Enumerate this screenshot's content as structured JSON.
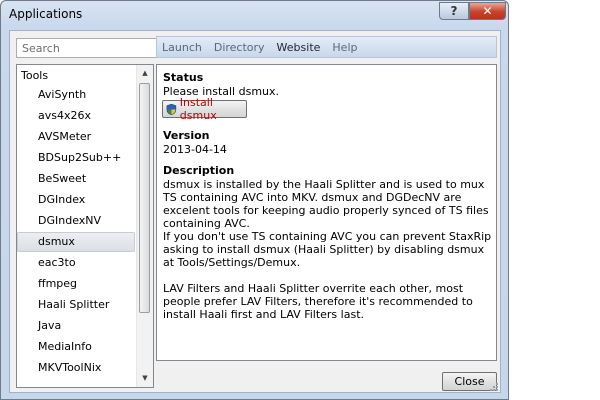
{
  "window": {
    "title": "Applications",
    "help_label": "?",
    "close_glyph": "✕"
  },
  "search": {
    "placeholder": "Search",
    "value": ""
  },
  "menu": [
    {
      "label": "Launch",
      "active": false
    },
    {
      "label": "Directory",
      "active": false
    },
    {
      "label": "Website",
      "active": true
    },
    {
      "label": "Help",
      "active": false
    }
  ],
  "tree": {
    "root": "Tools",
    "items": [
      {
        "label": "AviSynth"
      },
      {
        "label": "avs4x26x"
      },
      {
        "label": "AVSMeter"
      },
      {
        "label": "BDSup2Sub++"
      },
      {
        "label": "BeSweet"
      },
      {
        "label": "DGIndex"
      },
      {
        "label": "DGIndexNV"
      },
      {
        "label": "dsmux",
        "selected": true
      },
      {
        "label": "eac3to"
      },
      {
        "label": "ffmpeg"
      },
      {
        "label": "Haali Splitter"
      },
      {
        "label": "Java"
      },
      {
        "label": "MediaInfo"
      },
      {
        "label": "MKVToolNix"
      }
    ]
  },
  "detail": {
    "status_heading": "Status",
    "status_text": "Please install dsmux.",
    "install_button": "Install dsmux",
    "version_heading": "Version",
    "version_value": "2013-04-14",
    "description_heading": "Description",
    "description_paragraphs": [
      "dsmux is installed by the Haali Splitter and is used to mux TS containing AVC into MKV. dsmux and DGDecNV are excelent tools for keeping audio properly synced of TS files containing AVC.",
      "If you don't use TS containing AVC you can prevent StaxRip asking to install dsmux (Haali Splitter) by disabling dsmux at Tools/Settings/Demux.",
      "LAV Filters and Haali Splitter overrite each other, most people prefer LAV Filters, therefore it's recommended to install Haali first and LAV Filters last."
    ]
  },
  "footer": {
    "close_label": "Close"
  },
  "icons": {
    "install": "uac-shield-icon"
  },
  "colors": {
    "install_text": "#c00000",
    "titlebar_close": "#c9412b",
    "menubar": "#c8d7ea"
  }
}
